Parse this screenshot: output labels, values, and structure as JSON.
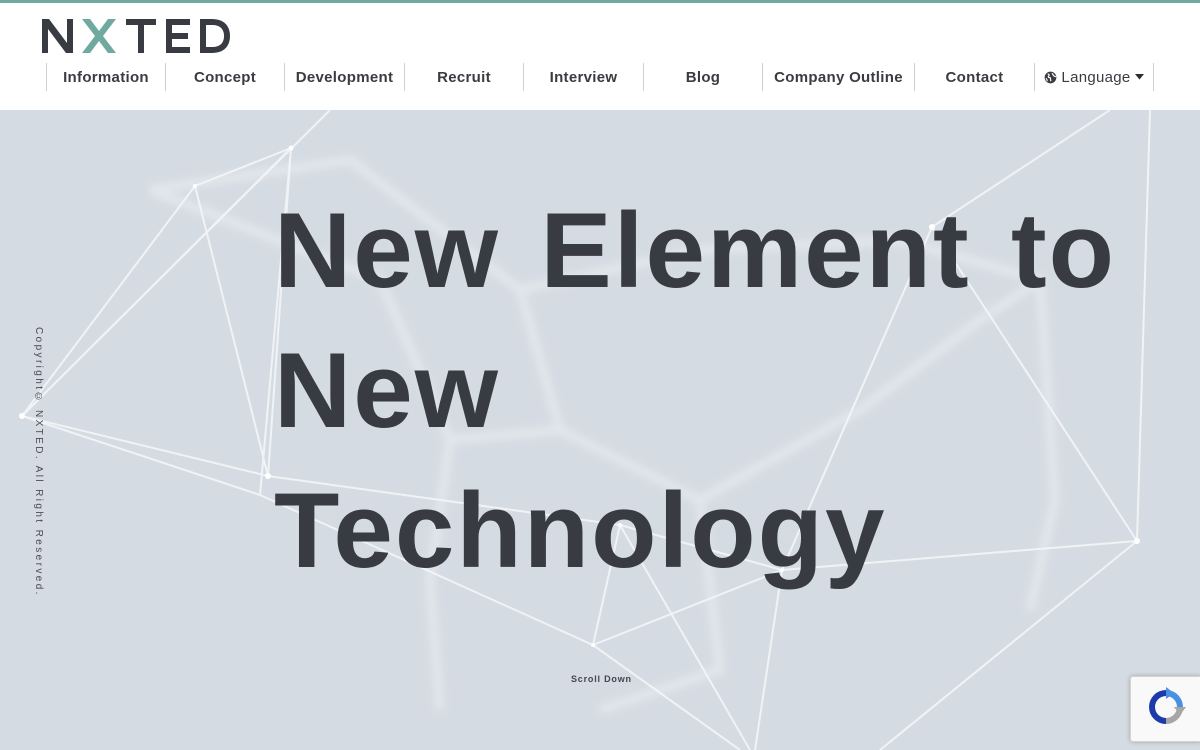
{
  "brand": {
    "name": "NXTED",
    "accent_color": "#6fa9a0",
    "text_color": "#393b43"
  },
  "nav": {
    "items": [
      {
        "label": "Information"
      },
      {
        "label": "Concept"
      },
      {
        "label": "Development"
      },
      {
        "label": "Recruit"
      },
      {
        "label": "Interview"
      },
      {
        "label": "Blog"
      },
      {
        "label": "Company Outline"
      },
      {
        "label": "Contact"
      }
    ],
    "language": {
      "label": "Language",
      "icon": "globe-icon",
      "caret": "caret-down-icon"
    }
  },
  "hero": {
    "headline_line1_words": [
      "New",
      "Element",
      "to"
    ],
    "headline_line2": "New Technology",
    "copyright": "Copyright© NXTED. All Right Reserved.",
    "scroll_label": "Scroll Down",
    "background_color": "#d5dbe2"
  },
  "recaptcha": {
    "icon": "recaptcha-icon"
  }
}
